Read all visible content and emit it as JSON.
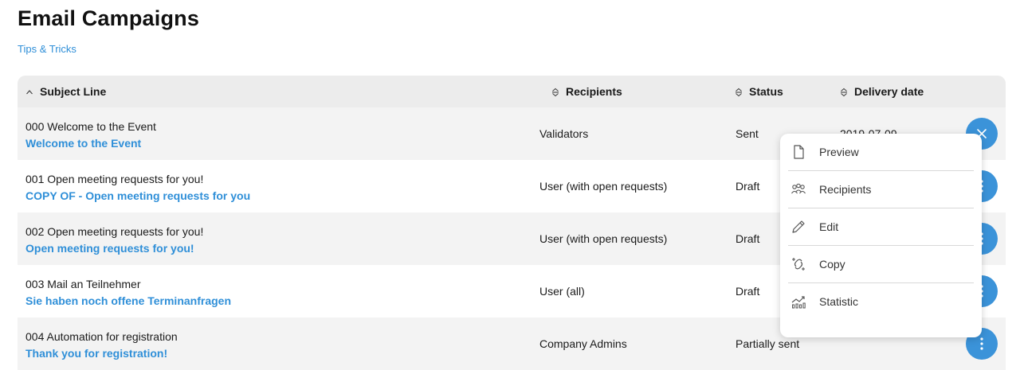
{
  "page": {
    "title": "Email Campaigns",
    "tips_link": "Tips & Tricks"
  },
  "table": {
    "columns": [
      {
        "label": "Subject Line",
        "sort_icon": "sort-ascending-icon"
      },
      {
        "label": "Recipients",
        "sort_icon": "sort-both-icon"
      },
      {
        "label": "Status",
        "sort_icon": "sort-both-icon"
      },
      {
        "label": "Delivery date",
        "sort_icon": "sort-both-icon"
      }
    ],
    "rows": [
      {
        "subject": "000 Welcome to the Event",
        "link": "Welcome to the Event",
        "recipients": "Validators",
        "status": "Sent",
        "date": "2019-07-09",
        "action_icon": "close-icon"
      },
      {
        "subject": "001 Open meeting requests for you!",
        "link": "COPY OF - Open meeting requests for you",
        "recipients": "User (with open requests)",
        "status": "Draft",
        "date": "",
        "action_icon": "more-vertical-icon"
      },
      {
        "subject": "002 Open meeting requests for you!",
        "link": "Open meeting requests for you!",
        "recipients": "User (with open requests)",
        "status": "Draft",
        "date": "",
        "action_icon": "more-vertical-icon"
      },
      {
        "subject": "003 Mail an Teilnehmer",
        "link": "Sie haben noch offene Terminanfragen",
        "recipients": "User (all)",
        "status": "Draft",
        "date": "",
        "action_icon": "more-vertical-icon"
      },
      {
        "subject": "004 Automation for registration",
        "link": "Thank you for registration!",
        "recipients": "Company Admins",
        "status": "Partially sent",
        "date": "",
        "action_icon": "more-vertical-icon"
      }
    ]
  },
  "action_menu": {
    "items": [
      {
        "label": "Preview",
        "icon": "document-icon"
      },
      {
        "label": "Recipients",
        "icon": "users-icon"
      },
      {
        "label": "Edit",
        "icon": "pencil-icon"
      },
      {
        "label": "Copy",
        "icon": "copy-icon"
      },
      {
        "label": "Statistic",
        "icon": "chart-icon"
      }
    ]
  },
  "colors": {
    "accent": "#3b93d9",
    "link": "#2f8fd8",
    "header_bg": "#ececec",
    "alt_row_bg": "#f3f3f3"
  }
}
